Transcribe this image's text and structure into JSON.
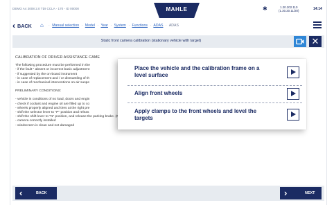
{
  "status": {
    "device_info": "DEMO A4 2008 2.0 TDI CCLA - 170 - ID 00000",
    "brand": "MAHLE",
    "bluetooth_icon": "bluetooth-icon",
    "ip_line1": "1.20.202.110",
    "ip_line2": "(1.30.20.11/20)",
    "time": "14:14"
  },
  "nav": {
    "back_label": "BACK",
    "home_icon": "home-icon",
    "breadcrumb": [
      "Manual selection",
      "Model",
      "Year",
      "System",
      "Functions",
      "ADAS"
    ],
    "current": "ADAS",
    "menu_icon": "hamburger-menu-icon"
  },
  "title": {
    "text": "Static front camera calibration (stationary vehicle with target)",
    "camera_icon": "video-camera-icon",
    "close_icon": "close-icon"
  },
  "content": {
    "heading": "CALIBRATION OF DRIVER ASSISTANCE CAME",
    "intro_lines": [
      "The following procedure must be performed in the",
      "- if the fault \" absent or incorrect basic adjustment",
      "- if suggested by the on-board instrument",
      "- in case of replacement and / or dismantling of th",
      "- in case of mechanical interventions on air suspe"
    ],
    "preliminary_heading": "PRELIMINARY CONDITIONS:",
    "condition_lines": [
      "- vehicle in conditions of no load, doors and engin",
      "- check if coolant and engine oil are filled up to co",
      "- wheels properly aligned and tires at the right pre",
      "- shift the selector lever to \"P\" position and releas",
      "- shift the shift lever to \"N\" position, and release the parking brake. (M/T models)",
      "- camera correctly installed",
      "- windscreen is clean and not damaged"
    ]
  },
  "popup": {
    "items": [
      {
        "label": "Place the vehicle and the calibration frame on a level surface"
      },
      {
        "label": "Align front wheels"
      },
      {
        "label": "Apply clamps to the front wheels and level the targets"
      }
    ]
  },
  "footer": {
    "back_label": "BACK",
    "next_label": "NEXT"
  },
  "colors": {
    "navy": "#1b2b63",
    "accent_blue": "#2f86d6",
    "link_blue": "#2a63c0",
    "bar_grey": "#e7ebf0"
  }
}
